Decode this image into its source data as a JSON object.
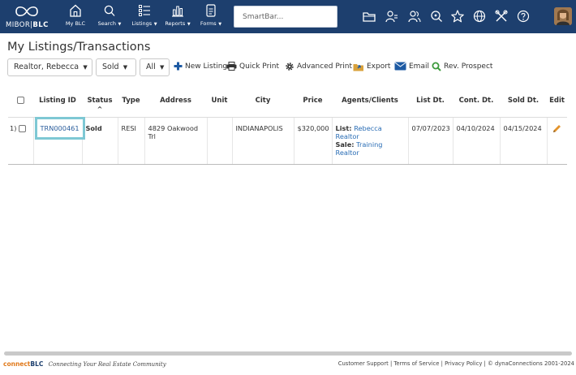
{
  "nav": {
    "logo_prefix": "MIBOR",
    "logo_suffix": "BLC",
    "items": [
      {
        "label": "My BLC",
        "icon": "home-icon"
      },
      {
        "label": "Search",
        "icon": "search-icon"
      },
      {
        "label": "Listings",
        "icon": "list-icon"
      },
      {
        "label": "Reports",
        "icon": "bar-chart-icon"
      },
      {
        "label": "Forms",
        "icon": "document-icon"
      }
    ],
    "smartbar_placeholder": "SmartBar...",
    "tool_icons": [
      "folder-icon",
      "contacts-icon",
      "users-icon",
      "saved-search-icon",
      "star-icon",
      "globe-icon",
      "tools-icon",
      "help-icon"
    ]
  },
  "page": {
    "title": "My Listings/Transactions"
  },
  "toolbar": {
    "agent_select": "Realtor, Rebecca",
    "status_select": "Sold",
    "type_select": "All",
    "new_listing": "New Listing",
    "quick_print": "Quick Print",
    "advanced_print": "Advanced Print",
    "export": "Export",
    "email": "Email",
    "rev_prospect": "Rev. Prospect"
  },
  "table": {
    "columns": [
      "Listing ID",
      "Status",
      "Type",
      "Address",
      "Unit",
      "City",
      "Price",
      "Agents/Clients",
      "List Dt.",
      "Cont. Dt.",
      "Sold Dt.",
      "Edit"
    ],
    "rows": [
      {
        "index": "1)",
        "listing_id": "TRN000461",
        "status": "Sold",
        "type": "RESI",
        "address": "4829 Oakwood Trl",
        "unit": "",
        "city": "INDIANAPOLIS",
        "price": "$320,000",
        "list_label": "List:",
        "list_agent": "Rebecca Realtor",
        "sale_label": "Sale:",
        "sale_agent": "Training Realtor",
        "list_date": "07/07/2023",
        "cont_date": "04/10/2024",
        "sold_date": "04/15/2024"
      }
    ]
  },
  "footer": {
    "brand_connect": "connect",
    "brand_blc": "BLC",
    "tagline": "Connecting Your Real Estate Community",
    "customer_support": "Customer Support",
    "terms": "Terms of Service",
    "privacy": "Privacy Policy",
    "copyright": "© dynaConnections 2001-2024"
  },
  "colors": {
    "nav_bg": "#1d3f6e",
    "accent_link": "#2a6db5",
    "highlight": "#7ec8d4",
    "brand_orange": "#e07a1c"
  }
}
